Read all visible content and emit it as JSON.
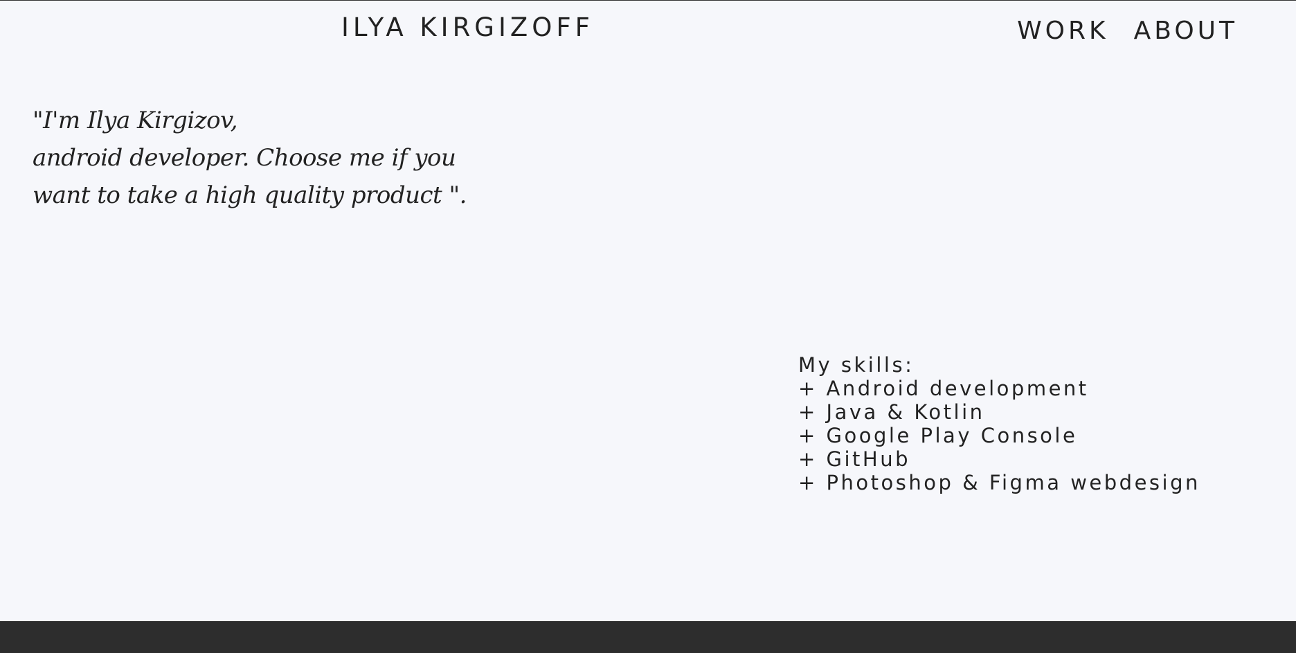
{
  "header": {
    "site_title": "ILYA KIRGIZOFF",
    "nav": {
      "work": "WORK",
      "about": "ABOUT"
    }
  },
  "intro": {
    "lines": [
      "\"I'm Ilya Kirgizov,",
      "android developer. Choose me if you",
      "want to take a high quality product \"."
    ]
  },
  "skills": {
    "heading": "My skills:",
    "items": [
      "+ Android development",
      "+ Java & Kotlin",
      "+ Google Play Console",
      "+ GitHub",
      "+ Photoshop & Figma webdesign"
    ]
  },
  "colors": {
    "background": "#f6f7fb",
    "text": "#222222",
    "footer": "#2d2d2d"
  }
}
